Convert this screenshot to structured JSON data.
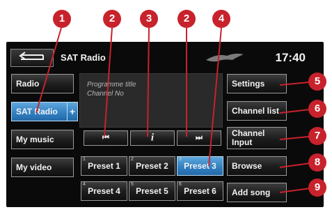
{
  "header": {
    "title": "SAT Radio",
    "clock": "17:40"
  },
  "source_menu": [
    {
      "label": "Radio",
      "selected": false
    },
    {
      "label": "SAT Radio",
      "selected": true,
      "extra": "+"
    },
    {
      "label": "My music",
      "selected": false
    },
    {
      "label": "My video",
      "selected": false
    }
  ],
  "info": {
    "line1": "Programme title",
    "line2": "Channel No"
  },
  "transport": {
    "prev": "⏮",
    "info": "i",
    "next": "⏭"
  },
  "presets": [
    {
      "num": "1",
      "label": "Preset 1",
      "selected": false
    },
    {
      "num": "2",
      "label": "Preset 2",
      "selected": false
    },
    {
      "num": "3",
      "label": "Preset 3",
      "selected": true
    },
    {
      "num": "4",
      "label": "Preset 4",
      "selected": false
    },
    {
      "num": "5",
      "label": "Preset 5",
      "selected": false
    },
    {
      "num": "6",
      "label": "Preset 6",
      "selected": false
    }
  ],
  "right_menu": [
    {
      "label": "Settings"
    },
    {
      "label": "Channel list"
    },
    {
      "label": "Channel\nInput"
    },
    {
      "label": "Browse"
    },
    {
      "label": "Add song"
    }
  ],
  "callouts": [
    "1",
    "2",
    "3",
    "2",
    "4",
    "5",
    "6",
    "7",
    "8",
    "9"
  ],
  "colors": {
    "callout": "#c8222c",
    "selected": "#2f7ec0",
    "screen": "#0a0a0a"
  }
}
